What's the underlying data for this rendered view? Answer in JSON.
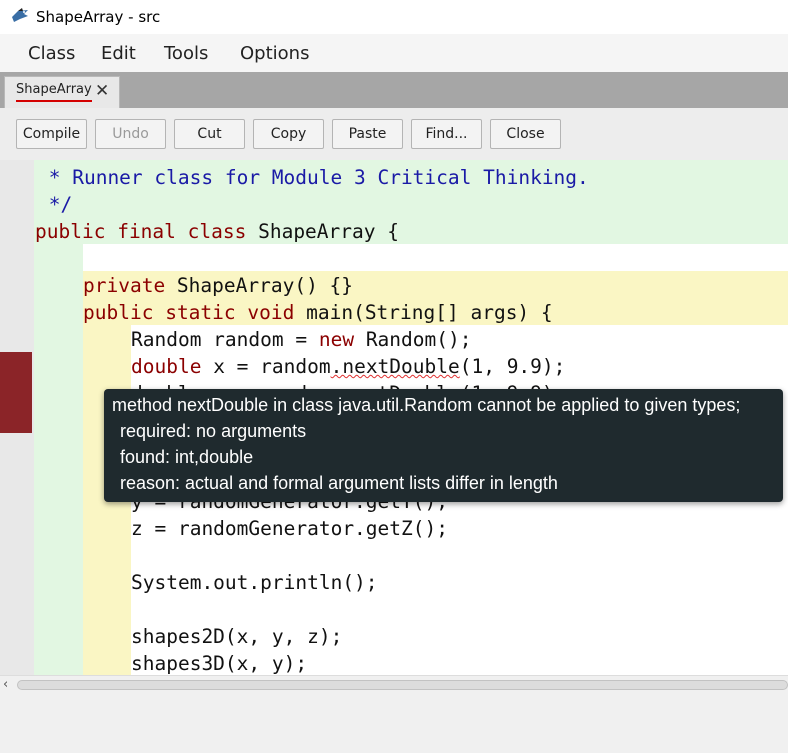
{
  "window": {
    "title": "ShapeArray - src"
  },
  "menu": [
    "Class",
    "Edit",
    "Tools",
    "Options"
  ],
  "tab": {
    "label": "ShapeArray",
    "close_glyph": "✕"
  },
  "toolbar": {
    "compile": "Compile",
    "undo": "Undo",
    "cut": "Cut",
    "copy": "Copy",
    "paste": "Paste",
    "find": "Find...",
    "close": "Close"
  },
  "code": {
    "l1_comment": " * Runner class for Module 3 Critical Thinking.",
    "l2_comment": " */",
    "l3_kw1": "public",
    "l3_kw2": "final",
    "l3_kw3": "class",
    "l3_rest": " ShapeArray {",
    "l5_kw": "private",
    "l5_rest": " ShapeArray() {}",
    "l6_kw1": "public",
    "l6_kw2": "static",
    "l6_kw3": "void",
    "l6_rest": " main(String[] args) {",
    "l7_a": "Random random = ",
    "l7_kw": "new",
    "l7_b": " Random();",
    "l8_kw": "double",
    "l8_a": " x = random",
    "l8_err": ".nextDouble",
    "l8_b": "(1, 9.9);",
    "l9_partial": "double y = random.nextDouble(1, 9.9);",
    "l10_partial": "y = randomGenerator.getY();",
    "l11": "z = randomGenerator.getZ();",
    "l13": "System.out.println();",
    "l15": "shapes2D(x, y, z);",
    "l16": "shapes3D(x, y);"
  },
  "tooltip": {
    "line1": "method nextDouble in class java.util.Random cannot be applied to given types;",
    "line2": "required: no arguments",
    "line3": "found: int,double",
    "line4": "reason: actual and formal argument lists differ in length"
  },
  "colors": {
    "keyword": "#8b0000",
    "comment": "#1a1aa6",
    "error_marker": "#8b2428",
    "scope_green": "#e2f7e2",
    "scope_yellow": "#faf6c4",
    "tooltip_bg": "#1f2a2e"
  }
}
